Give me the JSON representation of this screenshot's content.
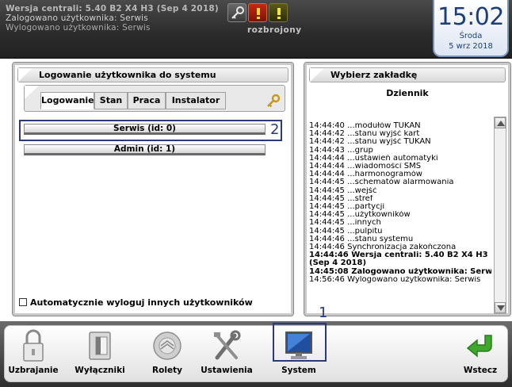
{
  "header": {
    "line1": "Wersja centrali: 5.40 B2 X4 H3 (Sep  4 2018)",
    "line2": "Zalogowano użytkownika: Serwis",
    "line3": "Wylogowano użytkownika: Serwis",
    "status": "rozbrojony",
    "icons": [
      "key-icon",
      "alarm-icon",
      "warning-icon"
    ]
  },
  "clock": {
    "time": "15:02",
    "day": "Środa",
    "date": "5 wrz 2018"
  },
  "left_panel": {
    "title": "Logowanie użytkownika do systemu",
    "tabs": [
      {
        "label": "Logowanie",
        "active": true
      },
      {
        "label": "Stan",
        "active": false
      },
      {
        "label": "Praca",
        "active": false
      },
      {
        "label": "Instalator",
        "active": false
      }
    ],
    "users": [
      {
        "label": "Serwis (id: 0)"
      },
      {
        "label": "Admin (id: 1)"
      }
    ],
    "annotation_2": "2",
    "auto_logout_label": "Automatycznie wyloguj innych użytkowników"
  },
  "right_panel": {
    "title": "Wybierz zakładkę",
    "heading": "Dziennik",
    "log": [
      {
        "time": "14:44:40",
        "text": "...modułów TUKAN",
        "bold": false
      },
      {
        "time": "14:44:42",
        "text": "...stanu wyjść kart",
        "bold": false
      },
      {
        "time": "14:44:42",
        "text": "...stanu wyjść TUKAN",
        "bold": false
      },
      {
        "time": "14:44:43",
        "text": "...grup",
        "bold": false
      },
      {
        "time": "14:44:44",
        "text": "...ustawień automatyki",
        "bold": false
      },
      {
        "time": "14:44:44",
        "text": "...wiadomości SMS",
        "bold": false
      },
      {
        "time": "14:44:44",
        "text": "...harmonogramów",
        "bold": false
      },
      {
        "time": "14:44:45",
        "text": "...schematów alarmowania",
        "bold": false
      },
      {
        "time": "14:44:45",
        "text": "...wejść",
        "bold": false
      },
      {
        "time": "14:44:45",
        "text": "...stref",
        "bold": false
      },
      {
        "time": "14:44:45",
        "text": "...partycji",
        "bold": false
      },
      {
        "time": "14:44:45",
        "text": "...użytkowników",
        "bold": false
      },
      {
        "time": "14:44:45",
        "text": "...innych",
        "bold": false
      },
      {
        "time": "14:44:45",
        "text": "...pulpitu",
        "bold": false
      },
      {
        "time": "14:44:46",
        "text": "...stanu systemu",
        "bold": false
      },
      {
        "time": "14:44:46",
        "text": "Synchronizacja zakończona",
        "bold": false
      },
      {
        "time": "14:44:46",
        "text": "Wersja centrali: 5.40 B2 X4 H3",
        "bold": true
      },
      {
        "time": "",
        "text": "(Sep  4 2018)",
        "bold": true
      },
      {
        "time": "14:45:08",
        "text": "Zalogowano użytkownika: Serwis",
        "bold": true
      },
      {
        "time": "14:56:46",
        "text": "Wylogowano użytkownika: Serwis",
        "bold": false
      }
    ]
  },
  "bottom_nav": {
    "items": [
      {
        "label": "Uzbrajanie",
        "icon": "padlock-icon"
      },
      {
        "label": "Wyłączniki",
        "icon": "wall-switch-icon"
      },
      {
        "label": "Rolety",
        "icon": "blinds-icon"
      },
      {
        "label": "Ustawienia",
        "icon": "tools-icon"
      },
      {
        "label": "System",
        "icon": "monitor-icon"
      },
      {
        "label": "Wstecz",
        "icon": "back-arrow-icon"
      }
    ],
    "annotation_1": "1"
  }
}
